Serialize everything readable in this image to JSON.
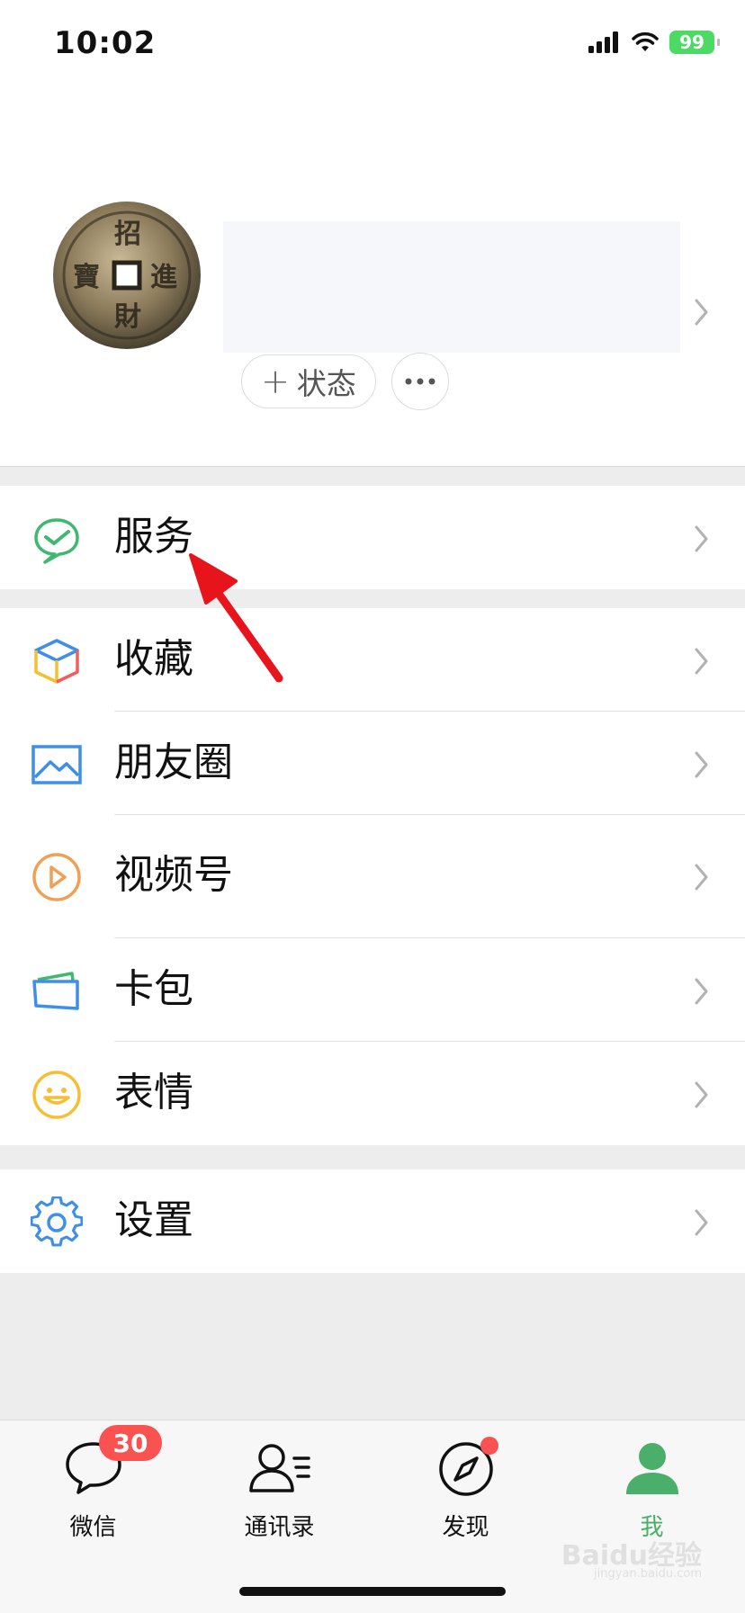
{
  "status_bar": {
    "time": "10:02",
    "battery": "99"
  },
  "profile": {
    "status_button": "状态"
  },
  "menu": {
    "services": {
      "label": "服务"
    },
    "items": [
      {
        "label": "收藏",
        "icon": "favorites-icon"
      },
      {
        "label": "朋友圈",
        "icon": "moments-icon"
      },
      {
        "label": "视频号",
        "icon": "channels-icon"
      },
      {
        "label": "卡包",
        "icon": "card-wallet-icon"
      },
      {
        "label": "表情",
        "icon": "stickers-icon"
      }
    ],
    "settings": {
      "label": "设置"
    }
  },
  "tabbar": {
    "tabs": [
      {
        "label": "微信",
        "badge": "30"
      },
      {
        "label": "通讯录"
      },
      {
        "label": "发现",
        "dot": true
      },
      {
        "label": "我",
        "active": true
      }
    ]
  },
  "watermark": {
    "brand": "Baidu经验",
    "url": "jingyan.baidu.com"
  },
  "colors": {
    "accent_green": "#4aaf6a",
    "badge_red": "#fa5151",
    "annotation_red": "#e8141c"
  }
}
